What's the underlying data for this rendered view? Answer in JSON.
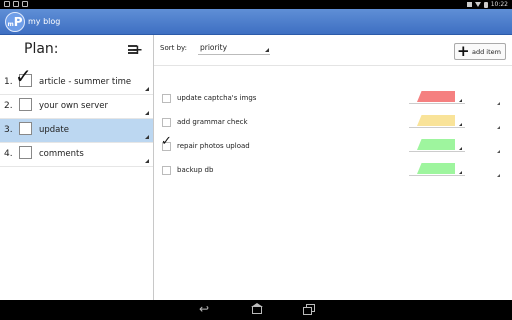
{
  "status_bar": {
    "time": "10:22"
  },
  "app": {
    "logo_letter": "P",
    "logo_small": "m",
    "title": "my blog"
  },
  "plan_panel": {
    "title": "Plan:",
    "items": [
      {
        "number": "1.",
        "label": "article - summer time",
        "checked": true,
        "selected": false
      },
      {
        "number": "2.",
        "label": "your own server",
        "checked": false,
        "selected": false
      },
      {
        "number": "3.",
        "label": "update",
        "checked": false,
        "selected": true
      },
      {
        "number": "4.",
        "label": "comments",
        "checked": false,
        "selected": false
      }
    ]
  },
  "toolbar": {
    "sort_label": "Sort by:",
    "sort_value": "priority",
    "add_item_label": "add item"
  },
  "tasks": [
    {
      "label": "update captcha's imgs",
      "checked": false,
      "priority_color": "#f58080"
    },
    {
      "label": "add grammar check",
      "checked": false,
      "priority_color": "#f9e399"
    },
    {
      "label": "repair photos upload",
      "checked": true,
      "priority_color": "#9ef59e"
    },
    {
      "label": "backup db",
      "checked": false,
      "priority_color": "#9ef59e"
    }
  ],
  "check_glyph": "✓"
}
